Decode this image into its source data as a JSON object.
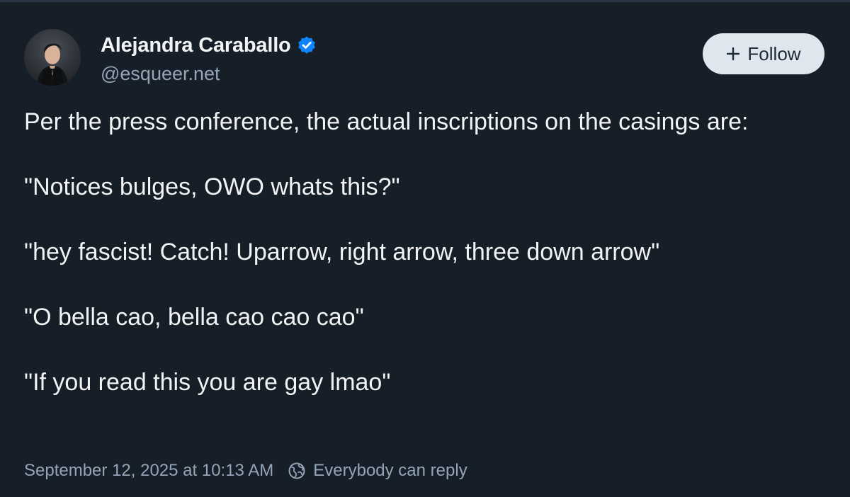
{
  "post": {
    "author": {
      "display_name": "Alejandra Caraballo",
      "handle": "@esqueer.net",
      "verified": true,
      "avatar": "profile-photo"
    },
    "follow_button": {
      "label": "Follow",
      "icon": "plus-icon"
    },
    "text_lines": [
      "Per the press conference, the actual inscriptions on the casings are:",
      "\"Notices bulges, OWO whats this?\"",
      "\"hey fascist! Catch! Uparrow, right arrow, three down arrow\"",
      "\"O bella cao, bella cao cao cao\"",
      "\"If you read this you are gay lmao\""
    ],
    "timestamp": "September 12, 2025 at 10:13 AM",
    "reply_setting": {
      "icon": "globe-icon",
      "label": "Everybody can reply"
    }
  },
  "colors": {
    "background": "#161e27",
    "text_primary": "#f1f3f5",
    "text_secondary": "#93a5b7",
    "verified_badge": "#1083fe",
    "follow_button_bg": "#dfe6ee"
  }
}
